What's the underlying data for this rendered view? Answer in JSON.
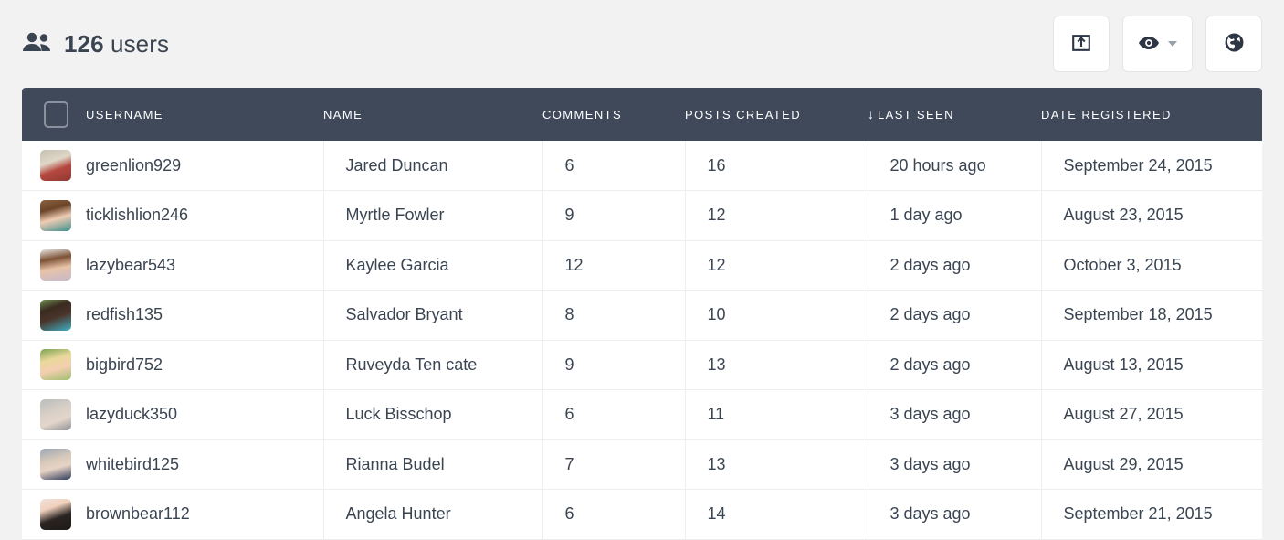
{
  "header": {
    "icon": "people-icon",
    "count": "126",
    "label": "users"
  },
  "toolbar": {
    "buttons": [
      {
        "name": "export-button",
        "icon": "export-box-icon",
        "label": ""
      },
      {
        "name": "visibility-button",
        "icon": "eye-icon",
        "label": "",
        "has_caret": true
      },
      {
        "name": "globe-button",
        "icon": "globe-icon",
        "label": ""
      }
    ]
  },
  "table": {
    "select_all_checked": false,
    "sort_column": "LAST SEEN",
    "sort_direction": "desc",
    "sort_arrow": "↓",
    "columns": [
      {
        "key": "checkbox",
        "label": ""
      },
      {
        "key": "username",
        "label": "USERNAME"
      },
      {
        "key": "name",
        "label": "NAME"
      },
      {
        "key": "comments",
        "label": "COMMENTS"
      },
      {
        "key": "posts_created",
        "label": "POSTS CREATED"
      },
      {
        "key": "last_seen",
        "label": "LAST SEEN"
      },
      {
        "key": "date_registered",
        "label": "DATE REGISTERED"
      }
    ],
    "rows": [
      {
        "username": "greenlion929",
        "name": "Jared Duncan",
        "comments": "6",
        "posts_created": "16",
        "last_seen": "20 hours ago",
        "date_registered": "September 24, 2015"
      },
      {
        "username": "ticklishlion246",
        "name": "Myrtle Fowler",
        "comments": "9",
        "posts_created": "12",
        "last_seen": "1 day ago",
        "date_registered": "August 23, 2015"
      },
      {
        "username": "lazybear543",
        "name": "Kaylee Garcia",
        "comments": "12",
        "posts_created": "12",
        "last_seen": "2 days ago",
        "date_registered": "October 3, 2015"
      },
      {
        "username": "redfish135",
        "name": "Salvador Bryant",
        "comments": "8",
        "posts_created": "10",
        "last_seen": "2 days ago",
        "date_registered": "September 18, 2015"
      },
      {
        "username": "bigbird752",
        "name": "Ruveyda Ten cate",
        "comments": "9",
        "posts_created": "13",
        "last_seen": "2 days ago",
        "date_registered": "August 13, 2015"
      },
      {
        "username": "lazyduck350",
        "name": "Luck Bisschop",
        "comments": "6",
        "posts_created": "11",
        "last_seen": "3 days ago",
        "date_registered": "August 27, 2015"
      },
      {
        "username": "whitebird125",
        "name": "Rianna Budel",
        "comments": "7",
        "posts_created": "13",
        "last_seen": "3 days ago",
        "date_registered": "August 29, 2015"
      },
      {
        "username": "brownbear112",
        "name": "Angela Hunter",
        "comments": "6",
        "posts_created": "14",
        "last_seen": "3 days ago",
        "date_registered": "September 21, 2015"
      }
    ]
  },
  "colors": {
    "page_background": "#f2f2f2",
    "table_header_background": "#3f495a",
    "text": "#3b4552",
    "row_border": "#eceef0",
    "button_border": "#e3e5e8"
  }
}
